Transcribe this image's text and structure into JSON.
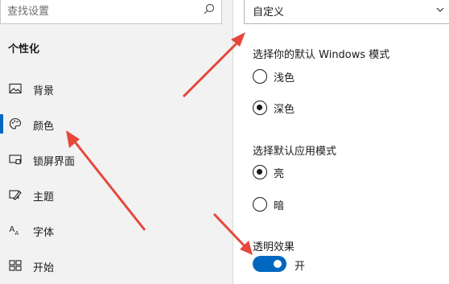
{
  "sidebar": {
    "search_placeholder": "查找设置",
    "section_title": "个性化",
    "items": [
      {
        "label": "背景",
        "icon": "picture-icon"
      },
      {
        "label": "颜色",
        "icon": "palette-icon"
      },
      {
        "label": "锁屏界面",
        "icon": "lock-screen-icon"
      },
      {
        "label": "主题",
        "icon": "theme-icon"
      },
      {
        "label": "字体",
        "icon": "font-icon"
      },
      {
        "label": "开始",
        "icon": "start-icon"
      }
    ],
    "selected": "颜色"
  },
  "main": {
    "color_dropdown_value": "自定义",
    "windows_mode": {
      "label": "选择你的默认 Windows 模式",
      "options": [
        "浅色",
        "深色"
      ],
      "selected": "深色"
    },
    "app_mode": {
      "label": "选择默认应用模式",
      "options": [
        "亮",
        "暗"
      ],
      "selected": "亮"
    },
    "transparency": {
      "label": "透明效果",
      "state_label": "开",
      "on": true
    }
  },
  "colors": {
    "accent": "#0067c0",
    "annotation_arrow": "#e5483b",
    "sidebar_bg": "#f2f2f2"
  }
}
